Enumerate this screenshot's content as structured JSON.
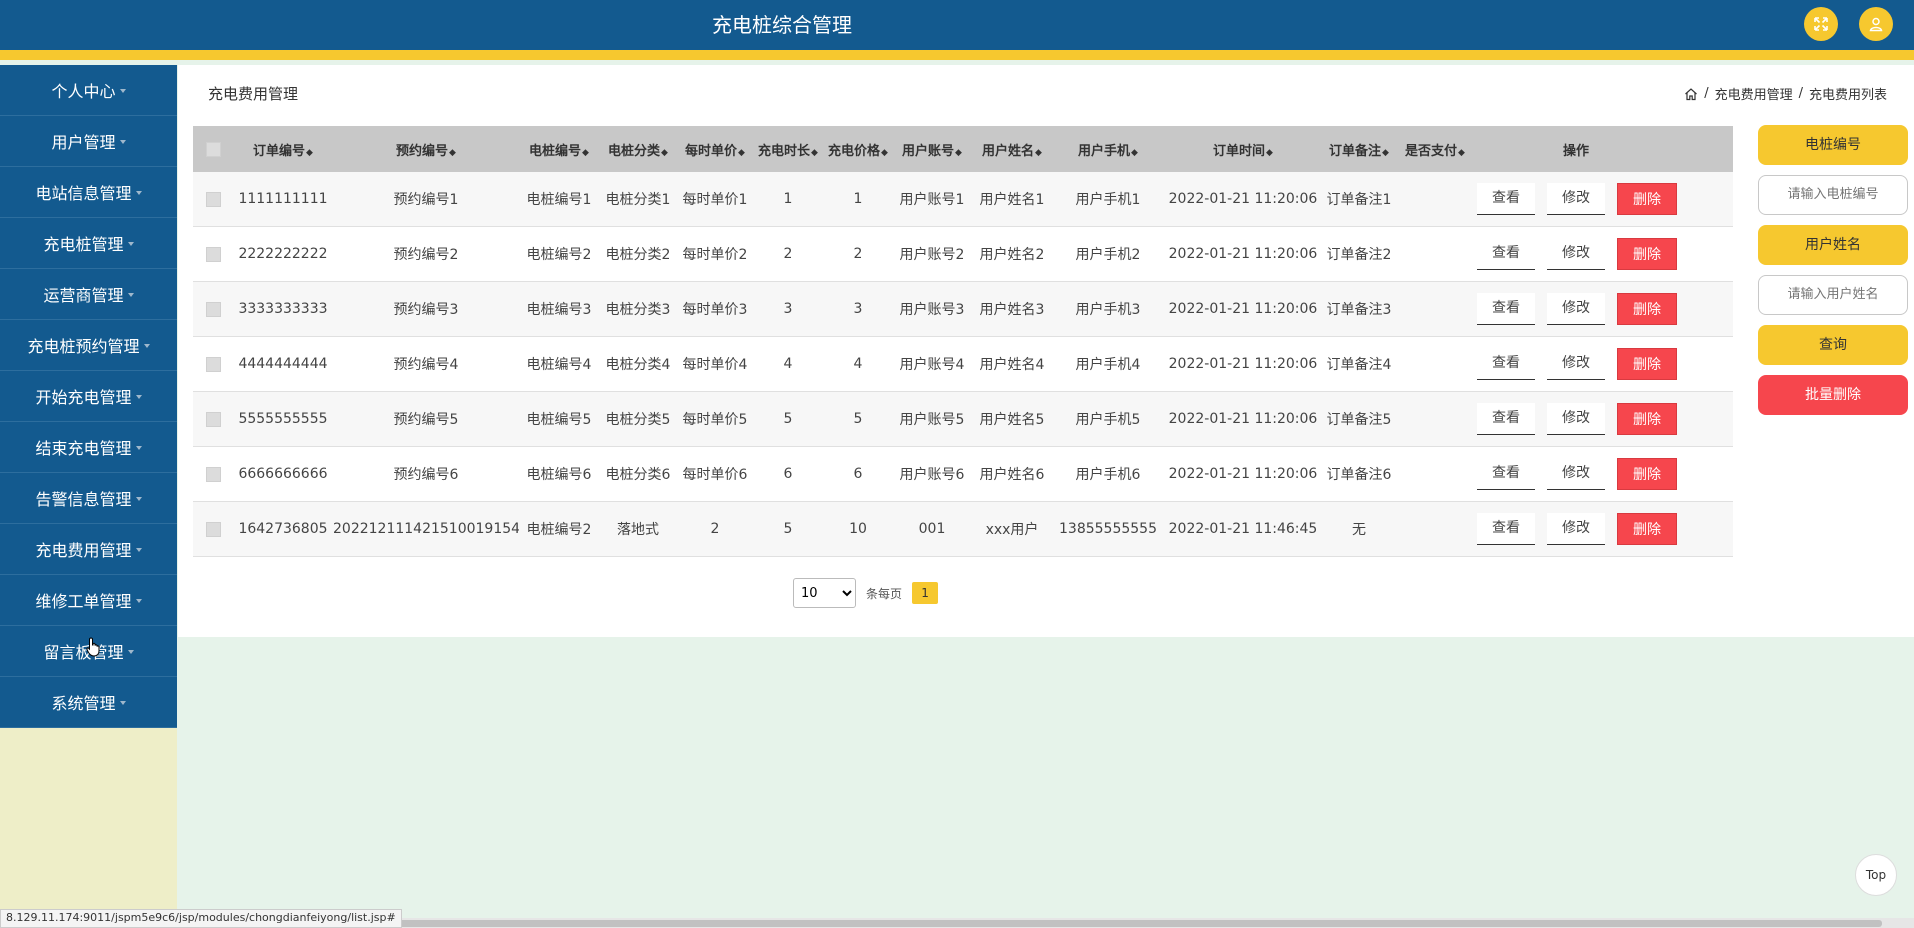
{
  "app": {
    "title": "充电桩综合管理"
  },
  "top_icons": {
    "fullscreen": "expand-icon",
    "user": "user-icon"
  },
  "sidebar": {
    "items": [
      {
        "label": "个人中心"
      },
      {
        "label": "用户管理"
      },
      {
        "label": "电站信息管理"
      },
      {
        "label": "充电桩管理"
      },
      {
        "label": "运营商管理"
      },
      {
        "label": "充电桩预约管理"
      },
      {
        "label": "开始充电管理"
      },
      {
        "label": "结束充电管理"
      },
      {
        "label": "告警信息管理"
      },
      {
        "label": "充电费用管理"
      },
      {
        "label": "维修工单管理"
      },
      {
        "label": "留言板管理"
      },
      {
        "label": "系统管理"
      }
    ]
  },
  "page": {
    "title": "充电费用管理",
    "breadcrumb": {
      "home_icon": "home-icon",
      "sep1": "/",
      "level1": "充电费用管理",
      "sep2": "/",
      "level2": "充电费用列表"
    }
  },
  "table": {
    "headers": {
      "order_no": "订单编号",
      "reserve_no": "预约编号",
      "pile_no": "电桩编号",
      "pile_type": "电桩分类",
      "unit_price": "每时单价",
      "duration": "充电时长",
      "price": "充电价格",
      "account": "用户账号",
      "name": "用户姓名",
      "phone": "用户手机",
      "time": "订单时间",
      "remark": "订单备注",
      "paid": "是否支付",
      "ops": "操作"
    },
    "sort_glyph": "◆",
    "actions": {
      "view": "查看",
      "edit": "修改",
      "delete": "删除"
    },
    "rows": [
      {
        "order_no": "1111111111",
        "reserve_no": "预约编号1",
        "pile_no": "电桩编号1",
        "pile_type": "电桩分类1",
        "unit_price": "每时单价1",
        "duration": "1",
        "price": "1",
        "account": "用户账号1",
        "name": "用户姓名1",
        "phone": "用户手机1",
        "time": "2022-01-21 11:20:06",
        "remark": "订单备注1",
        "paid": ""
      },
      {
        "order_no": "2222222222",
        "reserve_no": "预约编号2",
        "pile_no": "电桩编号2",
        "pile_type": "电桩分类2",
        "unit_price": "每时单价2",
        "duration": "2",
        "price": "2",
        "account": "用户账号2",
        "name": "用户姓名2",
        "phone": "用户手机2",
        "time": "2022-01-21 11:20:06",
        "remark": "订单备注2",
        "paid": ""
      },
      {
        "order_no": "3333333333",
        "reserve_no": "预约编号3",
        "pile_no": "电桩编号3",
        "pile_type": "电桩分类3",
        "unit_price": "每时单价3",
        "duration": "3",
        "price": "3",
        "account": "用户账号3",
        "name": "用户姓名3",
        "phone": "用户手机3",
        "time": "2022-01-21 11:20:06",
        "remark": "订单备注3",
        "paid": ""
      },
      {
        "order_no": "4444444444",
        "reserve_no": "预约编号4",
        "pile_no": "电桩编号4",
        "pile_type": "电桩分类4",
        "unit_price": "每时单价4",
        "duration": "4",
        "price": "4",
        "account": "用户账号4",
        "name": "用户姓名4",
        "phone": "用户手机4",
        "time": "2022-01-21 11:20:06",
        "remark": "订单备注4",
        "paid": ""
      },
      {
        "order_no": "5555555555",
        "reserve_no": "预约编号5",
        "pile_no": "电桩编号5",
        "pile_type": "电桩分类5",
        "unit_price": "每时单价5",
        "duration": "5",
        "price": "5",
        "account": "用户账号5",
        "name": "用户姓名5",
        "phone": "用户手机5",
        "time": "2022-01-21 11:20:06",
        "remark": "订单备注5",
        "paid": ""
      },
      {
        "order_no": "6666666666",
        "reserve_no": "预约编号6",
        "pile_no": "电桩编号6",
        "pile_type": "电桩分类6",
        "unit_price": "每时单价6",
        "duration": "6",
        "price": "6",
        "account": "用户账号6",
        "name": "用户姓名6",
        "phone": "用户手机6",
        "time": "2022-01-21 11:20:06",
        "remark": "订单备注6",
        "paid": ""
      },
      {
        "order_no": "1642736805",
        "reserve_no": "202212111421510019154",
        "pile_no": "电桩编号2",
        "pile_type": "落地式",
        "unit_price": "2",
        "duration": "5",
        "price": "10",
        "account": "001",
        "name": "xxx用户",
        "phone": "13855555555",
        "time": "2022-01-21 11:46:45",
        "remark": "无",
        "paid": ""
      }
    ]
  },
  "pagination": {
    "page_size": "10",
    "per_page_label": "条每页",
    "current_page": "1"
  },
  "search": {
    "pile_no_label": "电桩编号",
    "pile_no_placeholder": "请输入电桩编号",
    "user_name_label": "用户姓名",
    "user_name_placeholder": "请输入用户姓名",
    "search_button": "查询",
    "batch_delete_button": "批量删除"
  },
  "back_to_top": "Top",
  "status_url": "8.129.11.174:9011/jspm5e9c6/jsp/modules/chongdianfeiyong/list.jsp#",
  "colors": {
    "primary": "#135a8f",
    "accent": "#f6c82f",
    "danger": "#f6464d",
    "sidebar_bg": "#eeeec8",
    "content_bg": "#e6f3ea"
  }
}
